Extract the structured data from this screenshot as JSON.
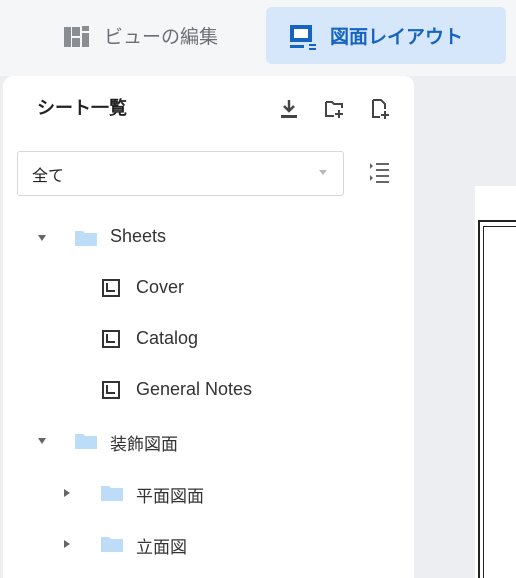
{
  "tabs": {
    "view_edit": "ビューの編集",
    "sheet_layout": "図面レイアウト"
  },
  "panel": {
    "title": "シート一覧",
    "filter_value": "全て"
  },
  "tree": {
    "sheets_folder": "Sheets",
    "cover": "Cover",
    "catalog": "Catalog",
    "general_notes": "General Notes",
    "decor_folder": "装飾図面",
    "plan_folder": "平面図面",
    "elevation_folder": "立面図"
  },
  "colors": {
    "accent": "#1565c0",
    "active_tab_bg": "#d6e6fb",
    "folder": "#bcdcf7"
  }
}
